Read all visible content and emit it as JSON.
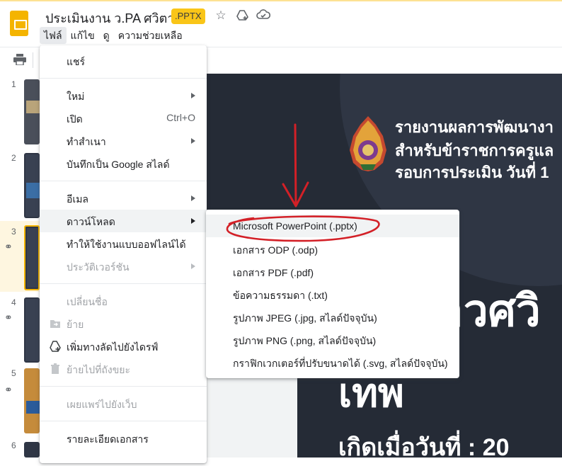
{
  "app": {
    "title": "ประเมินงาน ว.PA ศวิตา",
    "file_badge": ".PPTX",
    "icons": [
      "star-icon",
      "add-to-drive-icon",
      "cloud-status-icon"
    ]
  },
  "menubar": {
    "items": [
      {
        "label": "ไฟล์",
        "active": true
      },
      {
        "label": "แก้ไข",
        "active": false
      },
      {
        "label": "ดู",
        "active": false
      },
      {
        "label": "ความช่วยเหลือ",
        "active": false
      }
    ]
  },
  "filmstrip": {
    "slides": [
      {
        "number": "1",
        "selected": false,
        "linked": false
      },
      {
        "number": "2",
        "selected": false,
        "linked": false
      },
      {
        "number": "3",
        "selected": true,
        "linked": true
      },
      {
        "number": "4",
        "selected": false,
        "linked": true
      },
      {
        "number": "5",
        "selected": false,
        "linked": true
      },
      {
        "number": "6",
        "selected": false,
        "linked": false
      }
    ]
  },
  "slide": {
    "heading_lines": [
      "รายงานผลการพัฒนางา",
      "สำหรับข้าราชการครูแล",
      "รอบการประเมิน วันที่ 1"
    ],
    "big_name": "าวศวิ",
    "big_line2": "เทพ",
    "birth_line": "เกิดเมื่อวันที่ : 20"
  },
  "file_menu": {
    "items": [
      {
        "label": "แชร์",
        "shortcut": "",
        "submenu": false,
        "disabled": false,
        "icon": ""
      },
      {
        "label": "ใหม่",
        "shortcut": "",
        "submenu": true,
        "disabled": false,
        "icon": ""
      },
      {
        "label": "เปิด",
        "shortcut": "Ctrl+O",
        "submenu": false,
        "disabled": false,
        "icon": ""
      },
      {
        "label": "ทำสำเนา",
        "shortcut": "",
        "submenu": true,
        "disabled": false,
        "icon": ""
      },
      {
        "label": "บันทึกเป็น Google สไลด์",
        "shortcut": "",
        "submenu": false,
        "disabled": false,
        "icon": ""
      },
      {
        "label": "อีเมล",
        "shortcut": "",
        "submenu": true,
        "disabled": false,
        "icon": ""
      },
      {
        "label": "ดาวน์โหลด",
        "shortcut": "",
        "submenu": true,
        "disabled": false,
        "icon": "",
        "highlighted": true
      },
      {
        "label": "ทำให้ใช้งานแบบออฟไลน์ได้",
        "shortcut": "",
        "submenu": false,
        "disabled": false,
        "icon": ""
      },
      {
        "label": "ประวัติเวอร์ชัน",
        "shortcut": "",
        "submenu": true,
        "disabled": true,
        "icon": ""
      },
      {
        "label": "เปลี่ยนชื่อ",
        "shortcut": "",
        "submenu": false,
        "disabled": true,
        "icon": ""
      },
      {
        "label": "ย้าย",
        "shortcut": "",
        "submenu": false,
        "disabled": true,
        "icon": "move-folder-icon"
      },
      {
        "label": "เพิ่มทางลัดไปยังไดรฟ์",
        "shortcut": "",
        "submenu": false,
        "disabled": false,
        "icon": "add-shortcut-drive-icon"
      },
      {
        "label": "ย้ายไปที่ถังขยะ",
        "shortcut": "",
        "submenu": false,
        "disabled": true,
        "icon": "trash-icon"
      },
      {
        "label": "เผยแพร่ไปยังเว็บ",
        "shortcut": "",
        "submenu": false,
        "disabled": true,
        "icon": ""
      },
      {
        "label": "รายละเอียดเอกสาร",
        "shortcut": "",
        "submenu": false,
        "disabled": false,
        "icon": ""
      }
    ]
  },
  "download_submenu": {
    "items": [
      {
        "label": "Microsoft PowerPoint (.pptx)",
        "highlighted": true
      },
      {
        "label": "เอกสาร ODP (.odp)",
        "highlighted": false
      },
      {
        "label": "เอกสาร PDF (.pdf)",
        "highlighted": false
      },
      {
        "label": "ข้อความธรรมดา (.txt)",
        "highlighted": false
      },
      {
        "label": "รูปภาพ JPEG (.jpg, สไลด์ปัจจุบัน)",
        "highlighted": false
      },
      {
        "label": "รูปภาพ PNG (.png, สไลด์ปัจจุบัน)",
        "highlighted": false
      },
      {
        "label": "กราฟิกเวกเตอร์ที่ปรับขนาดได้ (.svg, สไลด์ปัจจุบัน)",
        "highlighted": false
      }
    ]
  },
  "annotation": {
    "color": "#d32027",
    "marks": [
      "red-arrow",
      "red-ellipse"
    ]
  },
  "colors": {
    "accent": "#f4b400",
    "badge": "#f9c518",
    "slide_bg": "#252b36"
  }
}
